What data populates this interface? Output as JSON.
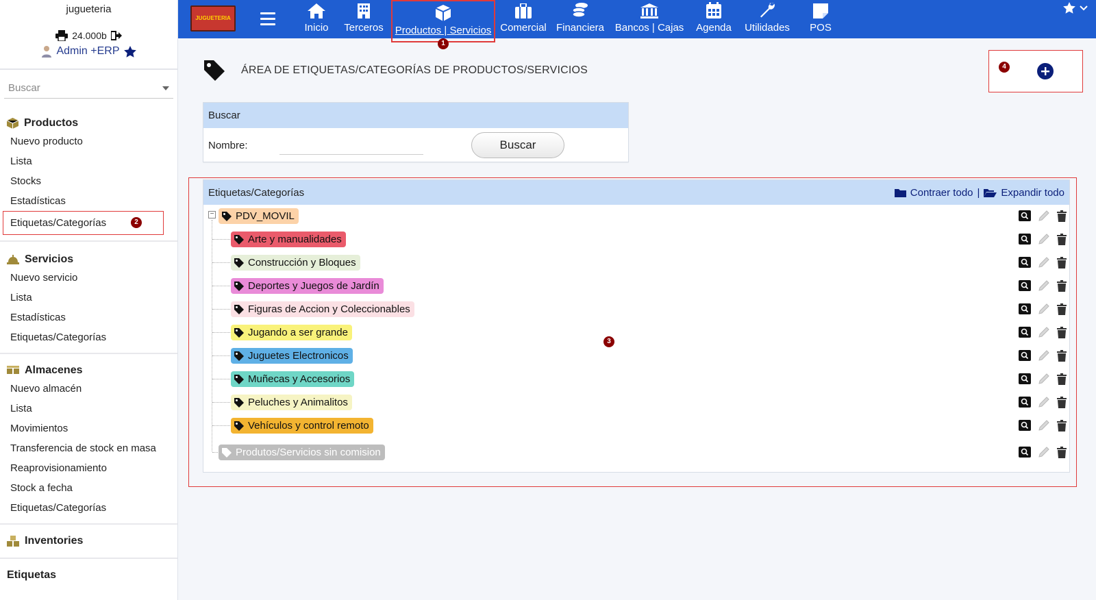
{
  "sidebar": {
    "company": "jugueteria",
    "amount": "24.000b",
    "user": "Admin +ERP",
    "search_placeholder": "Buscar",
    "sections": {
      "productos": {
        "title": "Productos",
        "items": [
          "Nuevo producto",
          "Lista",
          "Stocks",
          "Estadísticas",
          "Etiquetas/Categorías"
        ]
      },
      "servicios": {
        "title": "Servicios",
        "items": [
          "Nuevo servicio",
          "Lista",
          "Estadísticas",
          "Etiquetas/Categorías"
        ]
      },
      "almacenes": {
        "title": "Almacenes",
        "items": [
          "Nuevo almacén",
          "Lista",
          "Movimientos",
          "Transferencia de stock en masa",
          "Reaprovisionamiento",
          "Stock a fecha",
          "Etiquetas/Categorías"
        ]
      },
      "inventories": {
        "title": "Inventories"
      },
      "etiquetas": {
        "title": "Etiquetas"
      }
    }
  },
  "topbar": {
    "logo_text": "JUGUETERIA",
    "nav": [
      "Inicio",
      "Terceros",
      "Productos | Servicios",
      "Comercial",
      "Financiera",
      "Bancos | Cajas",
      "Agenda",
      "Utilidades",
      "POS"
    ]
  },
  "main": {
    "title": "ÁREA DE ETIQUETAS/CATEGORÍAS DE PRODUCTOS/SERVICIOS",
    "search": {
      "header": "Buscar",
      "name_label": "Nombre:",
      "name_value": "",
      "button": "Buscar"
    },
    "tree": {
      "header": "Etiquetas/Categorías",
      "collapse_all": "Contraer todo",
      "separator": "|",
      "expand_all": "Expandir todo",
      "root": {
        "label": "PDV_MOVIL",
        "color": "#fcd2a8"
      },
      "children": [
        {
          "label": "Arte y manualidades",
          "color": "#ea5b6b"
        },
        {
          "label": "Construcción y Bloques",
          "color": "#e6efd9"
        },
        {
          "label": "Deportes y Juegos de Jardín",
          "color": "#e98bd8"
        },
        {
          "label": "Figuras de Accion y Coleccionables",
          "color": "#fbe0e4"
        },
        {
          "label": "Jugando a ser grande",
          "color": "#f9f27a"
        },
        {
          "label": "Juguetes Electronicos",
          "color": "#5fb0e6"
        },
        {
          "label": "Muñecas y Accesorios",
          "color": "#6fd6c6"
        },
        {
          "label": "Peluches y Animalitos",
          "color": "#f6f4c4"
        },
        {
          "label": "Vehículos y control remoto",
          "color": "#f3b431"
        }
      ],
      "orphan": {
        "label": "Produtos/Servicios sin comision",
        "color": "#bdbdbd"
      }
    }
  },
  "markers": [
    "1",
    "2",
    "3",
    "4"
  ]
}
